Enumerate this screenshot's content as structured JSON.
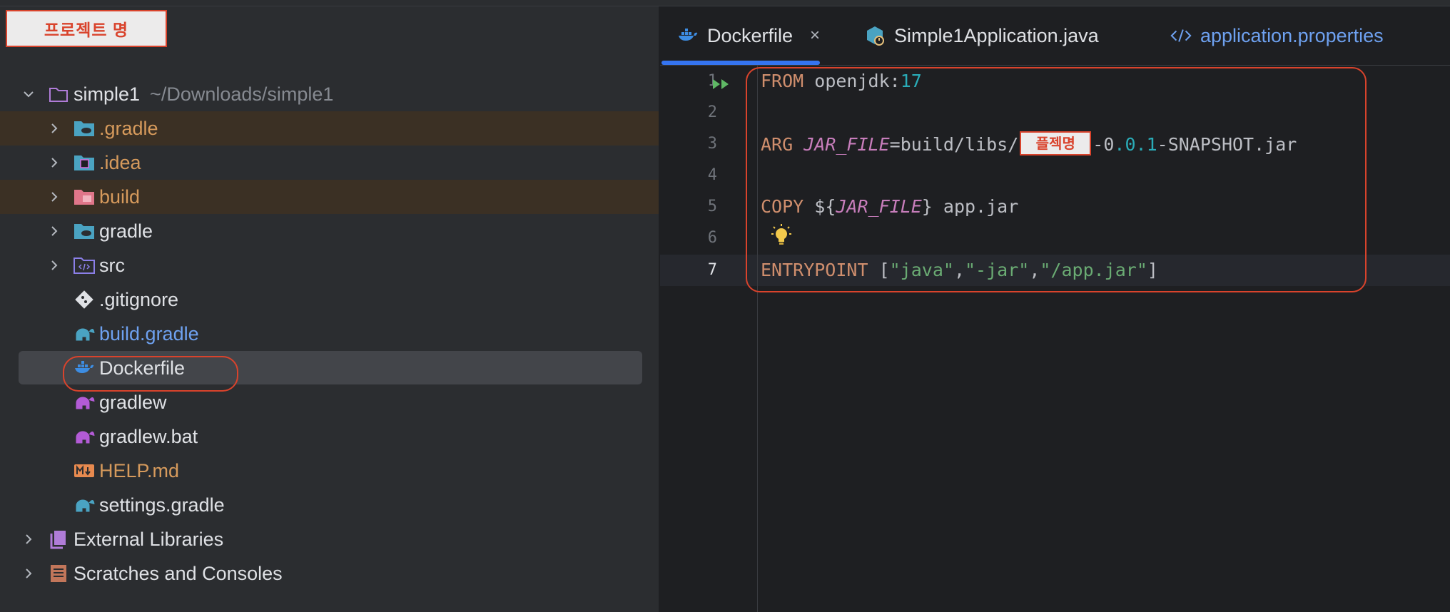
{
  "annotation": {
    "project_name_label": "프로젝트 명",
    "inline_project_label": "플젝명"
  },
  "project_tree": {
    "root": {
      "name": "simple1",
      "path": "~/Downloads/simple1"
    },
    "items": [
      {
        "label": ".gradle",
        "icon": "gradle-folder-icon",
        "expandable": true,
        "color": "orange"
      },
      {
        "label": ".idea",
        "icon": "idea-folder-icon",
        "expandable": true,
        "color": "orange"
      },
      {
        "label": "build",
        "icon": "build-folder-icon",
        "expandable": true,
        "color": "orange"
      },
      {
        "label": "gradle",
        "icon": "gradle-folder-icon",
        "expandable": true,
        "color": "white"
      },
      {
        "label": "src",
        "icon": "source-folder-icon",
        "expandable": true,
        "color": "white"
      },
      {
        "label": ".gitignore",
        "icon": "git-icon",
        "expandable": false,
        "color": "white"
      },
      {
        "label": "build.gradle",
        "icon": "gradle-elephant-icon",
        "expandable": false,
        "color": "blue"
      },
      {
        "label": "Dockerfile",
        "icon": "docker-icon",
        "expandable": false,
        "color": "white",
        "selected": true
      },
      {
        "label": "gradlew",
        "icon": "gradle-elephant-icon",
        "expandable": false,
        "color": "white"
      },
      {
        "label": "gradlew.bat",
        "icon": "gradle-elephant-icon",
        "expandable": false,
        "color": "white"
      },
      {
        "label": "HELP.md",
        "icon": "markdown-icon",
        "expandable": false,
        "color": "orange"
      },
      {
        "label": "settings.gradle",
        "icon": "gradle-elephant-icon",
        "expandable": false,
        "color": "white"
      }
    ],
    "external_libraries": "External Libraries",
    "scratches": "Scratches and Consoles"
  },
  "editor": {
    "tabs": [
      {
        "label": "Dockerfile",
        "icon": "docker-icon",
        "active": true,
        "close": "×"
      },
      {
        "label": "Simple1Application.java",
        "icon": "java-class-icon",
        "active": false
      },
      {
        "label": "application.properties",
        "icon": "code-tag-icon",
        "active": false
      }
    ],
    "line_numbers": [
      "1",
      "2",
      "3",
      "4",
      "5",
      "6",
      "7"
    ],
    "current_line": 7,
    "lines": {
      "l1": {
        "kw": "FROM",
        "image": " openjdk:",
        "version": "17"
      },
      "l3": {
        "kw": "ARG",
        "var": "JAR_FILE",
        "eq": "=build/libs/",
        "dash": "-",
        "v1": "0",
        "dot1": ".",
        "v2": "0",
        "dot2": ".",
        "v3": "1",
        "suffix": "-SNAPSHOT.jar"
      },
      "l5": {
        "kw": "COPY",
        "pre": " ${",
        "var": "JAR_FILE",
        "post": "} app.jar"
      },
      "l7": {
        "kw": "ENTRYPOINT",
        "open": " [",
        "s1": "\"java\"",
        "c1": ",",
        "s2": "\"-jar\"",
        "c2": ",",
        "s3": "\"/app.jar\"",
        "close": "]"
      }
    }
  },
  "colors": {
    "annotation_red": "#d9432c",
    "keyword": "#cf8e6d",
    "string": "#6aab73",
    "number": "#2aacb8",
    "variable": "#c77dbb",
    "accent_blue": "#3574f0"
  }
}
